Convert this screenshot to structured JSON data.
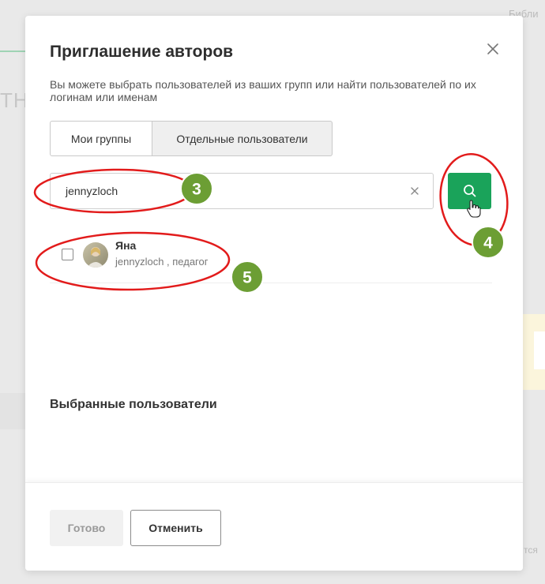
{
  "background": {
    "top_right_text": "Библи",
    "big_text": "ТН",
    "bottom_right_text": "тся"
  },
  "modal": {
    "title": "Приглашение авторов",
    "description": "Вы можете выбрать пользователей из ваших групп или найти пользователей по их логинам или именам",
    "tabs": [
      {
        "label": "Мои группы",
        "active": false
      },
      {
        "label": "Отдельные пользователи",
        "active": true
      }
    ],
    "search": {
      "value": "jennyzloch",
      "clear_icon": "close-icon",
      "button_icon": "search-icon"
    },
    "results": [
      {
        "name": "Яна",
        "meta": "jennyzloch , педагог",
        "checked": false
      }
    ],
    "selected_title": "Выбранные пользователи",
    "footer": {
      "done_label": "Готово",
      "cancel_label": "Отменить"
    }
  },
  "annotations": [
    {
      "label": "3"
    },
    {
      "label": "4"
    },
    {
      "label": "5"
    }
  ],
  "colors": {
    "accent_green": "#1aa35a",
    "badge_green": "#6c9e34",
    "annotation_red": "#e21b1b"
  }
}
